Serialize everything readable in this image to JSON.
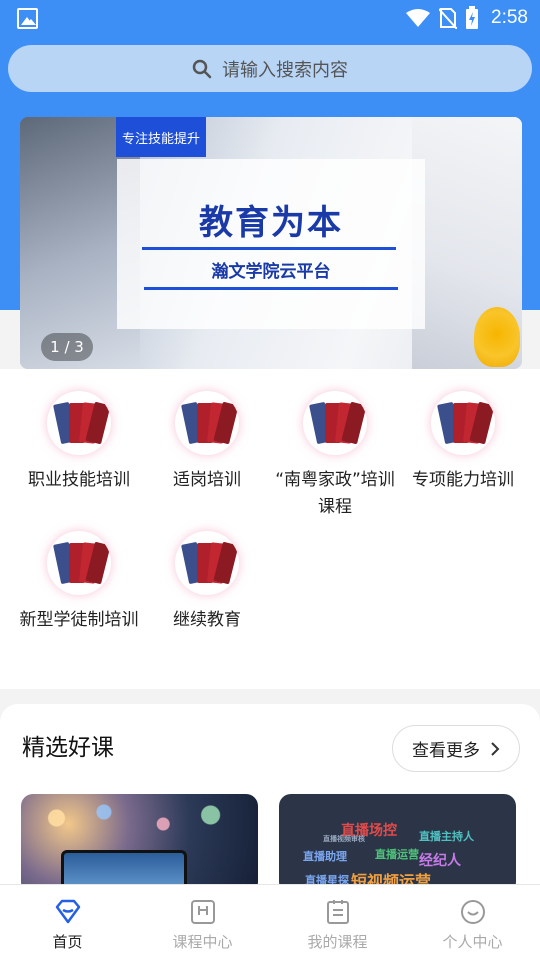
{
  "status_bar": {
    "time": "2:58"
  },
  "search": {
    "placeholder": "请输入搜索内容"
  },
  "banner": {
    "tag": "专注技能提升",
    "title": "教育为本",
    "subtitle": "瀚文学院云平台",
    "pager": "1 / 3"
  },
  "categories": [
    {
      "label": "职业技能培训"
    },
    {
      "label": "适岗培训"
    },
    {
      "label": "“南粤家政”培训课程"
    },
    {
      "label": "专项能力培训"
    },
    {
      "label": "新型学徒制培训"
    },
    {
      "label": "继续教育"
    }
  ],
  "featured": {
    "title": "精选好课",
    "more_label": "查看更多",
    "course2_words": [
      "直播场控",
      "直播主持人",
      "直播助理",
      "直播运营",
      "经纪人",
      "直播星探",
      "短视频运营",
      "直播视频审核"
    ]
  },
  "bottom_nav": [
    {
      "label": "首页",
      "active": true
    },
    {
      "label": "课程中心",
      "active": false
    },
    {
      "label": "我的课程",
      "active": false
    },
    {
      "label": "个人中心",
      "active": false
    }
  ],
  "colors": {
    "brand_blue": "#3d8ff6",
    "active_nav": "#2360e8",
    "banner_title": "#1a3aa8"
  }
}
